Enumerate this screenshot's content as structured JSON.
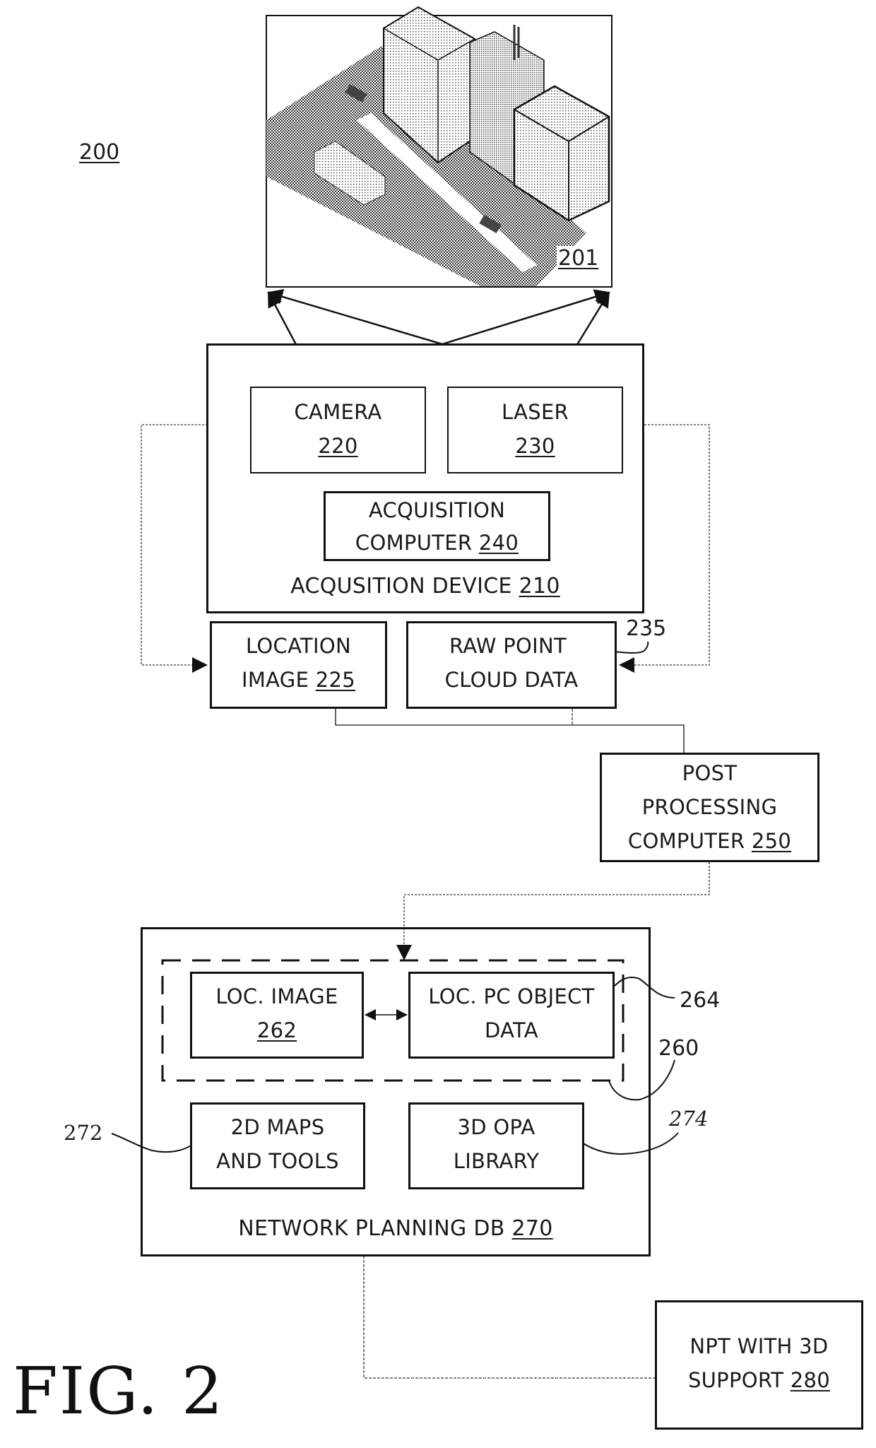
{
  "figure": {
    "caption": "FIG. 2",
    "system_ref": "200"
  },
  "scene": {
    "ref": "201",
    "description": "isometric street scene with buildings, vehicles"
  },
  "acquisition_device": {
    "label": "ACQUSITION DEVICE ",
    "ref": "210",
    "camera": {
      "label": "CAMERA",
      "ref": "220"
    },
    "laser": {
      "label": "LASER",
      "ref": "230"
    },
    "computer": {
      "line1": "ACQUISITION",
      "line2": "COMPUTER ",
      "ref": "240"
    }
  },
  "location_image": {
    "line1": "LOCATION",
    "line2": "IMAGE ",
    "ref": "225"
  },
  "raw_point_cloud": {
    "line1": "RAW POINT",
    "line2": "CLOUD DATA",
    "ref": "235"
  },
  "post_processing": {
    "line1": "POST",
    "line2": "PROCESSING",
    "line3": "COMPUTER ",
    "ref": "250"
  },
  "network_planning_db": {
    "label": "NETWORK PLANNING DB ",
    "ref": "270",
    "group_ref": "260",
    "loc_image": {
      "line1": "LOC. IMAGE",
      "ref": "262"
    },
    "loc_pc_object": {
      "line1": "LOC. PC OBJECT",
      "line2": "DATA",
      "ref": "264"
    },
    "maps_tools": {
      "line1": "2D MAPS",
      "line2": "AND TOOLS",
      "ref": "272"
    },
    "opa_library": {
      "line1": "3D OPA",
      "line2": "LIBRARY",
      "ref": "274"
    }
  },
  "npt": {
    "line1": "NPT WITH 3D",
    "line2": "SUPPORT ",
    "ref": "280"
  }
}
